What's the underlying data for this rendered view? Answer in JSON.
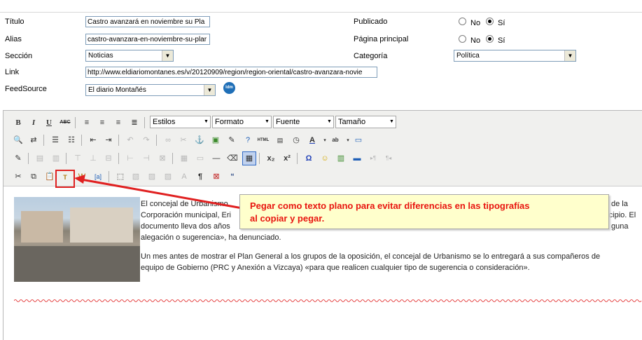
{
  "form": {
    "titulo_label": "Título",
    "titulo_value": "Castro avanzará en noviembre su Pla",
    "alias_label": "Alias",
    "alias_value": "castro-avanzara-en-noviembre-su-plar",
    "seccion_label": "Sección",
    "seccion_value": "Noticias",
    "link_label": "Link",
    "link_value": "http://www.eldiariomontanes.es/v/20120909/region/region-oriental/castro-avanzara-novie",
    "feedsource_label": "FeedSource",
    "feedsource_value": "El diario Montañés",
    "publicado_label": "Publicado",
    "pagina_label": "Página principal",
    "categoria_label": "Categoría",
    "categoria_value": "Política",
    "no_label": "No",
    "si_label": "Sí"
  },
  "toolbar": {
    "styles_label": "Estilos",
    "format_label": "Formato",
    "font_label": "Fuente",
    "size_label": "Tamaño"
  },
  "content": {
    "p1_line1": "El concejal de Urbanismo",
    "p1_line1_end": "de la",
    "p1_line2": "Corporación municipal, Eri",
    "p1_line2_end": "unicipio. El",
    "p1_line3": "documento lleva dos años",
    "p1_line3_end": "guna",
    "p1_line4": "alegación o sugerencia», ha denunciado.",
    "p2_line1": "Un mes antes de mostrar el Plan General a los grupos de la oposición, el concejal de Urbanismo se lo entregará a sus compañeros de",
    "p2_line2": "equipo de Gobierno (PRC y Anexión a Vizcaya) «para que realicen cualquier tipo de sugerencia o consideración»."
  },
  "callout": {
    "line1": "Pegar como texto plano para evitar diferencias en las tipografías",
    "line2": "al copiar y pegar."
  },
  "colors": {
    "callout_text": "#e8150f",
    "callout_bg": "#ffffcc",
    "arrow": "#e02020"
  }
}
